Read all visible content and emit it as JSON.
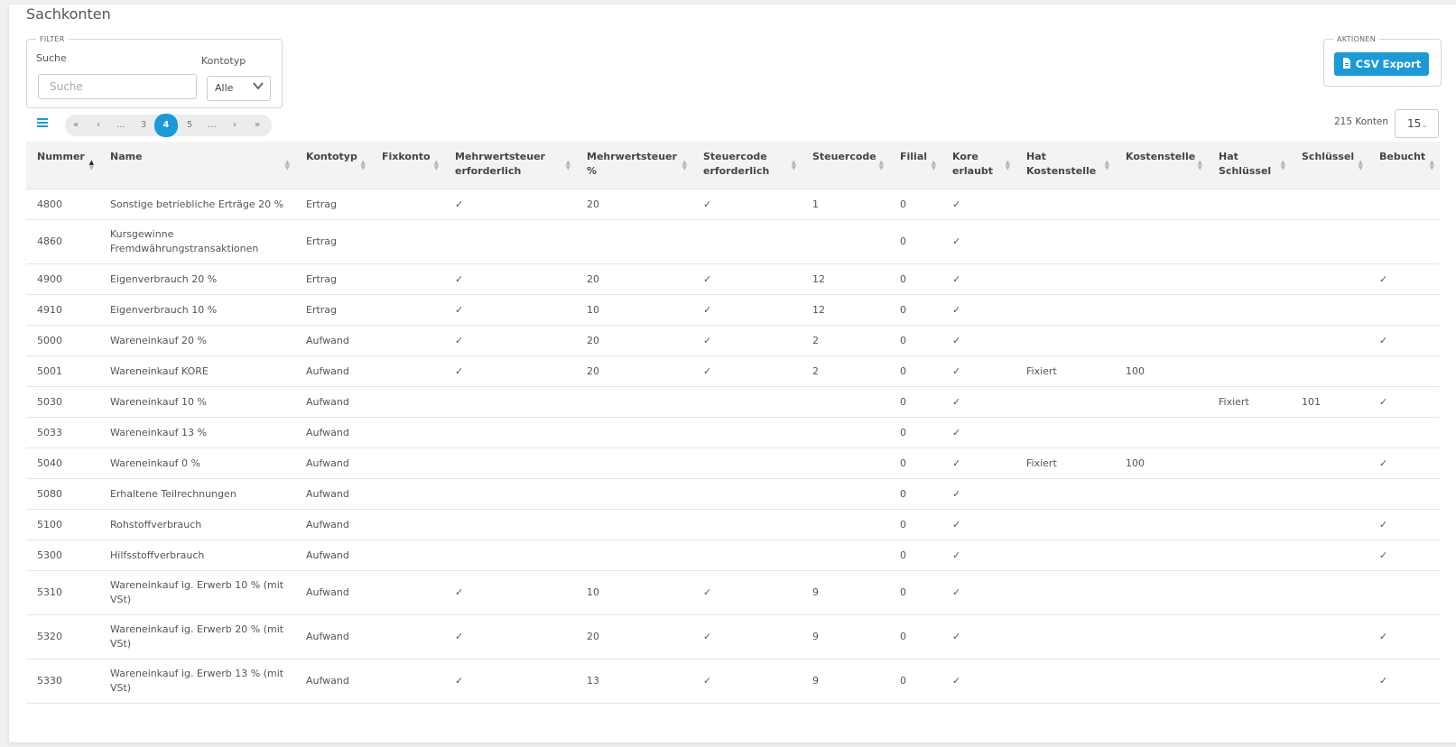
{
  "page": {
    "title": "Sachkonten"
  },
  "filter": {
    "legend": "FILTER",
    "search_label": "Suche",
    "search_placeholder": "Suche",
    "search_value": "",
    "type_label": "Kontotyp",
    "type_value": "Alle"
  },
  "actions": {
    "legend": "AKTIONEN",
    "csv_label": "CSV Export"
  },
  "pagination": {
    "first": "«",
    "prev": "‹",
    "ellipsis_left": "...",
    "page_before": "3",
    "current": "4",
    "page_after": "5",
    "ellipsis_right": "...",
    "next": "›",
    "last": "»"
  },
  "summary": {
    "count_text": "215 Konten",
    "per_page": "15"
  },
  "table": {
    "columns": [
      {
        "label": "Nummer",
        "sortable": true,
        "sorted": "asc"
      },
      {
        "label": "Name",
        "sortable": true
      },
      {
        "label": "Kontotyp",
        "sortable": true
      },
      {
        "label": "Fixkonto",
        "sortable": true
      },
      {
        "label": "Mehrwertsteuer erforderlich",
        "sortable": true
      },
      {
        "label": "Mehrwertsteuer %",
        "sortable": true
      },
      {
        "label": "Steuercode erforderlich",
        "sortable": true
      },
      {
        "label": "Steuercode",
        "sortable": true
      },
      {
        "label": "Filial",
        "sortable": true
      },
      {
        "label": "Kore erlaubt",
        "sortable": true
      },
      {
        "label": "Hat Kostenstelle",
        "sortable": true
      },
      {
        "label": "Kostenstelle",
        "sortable": true
      },
      {
        "label": "Hat Schlüssel",
        "sortable": true
      },
      {
        "label": "Schlüssel",
        "sortable": true
      },
      {
        "label": "Bebucht",
        "sortable": true
      }
    ],
    "rows": [
      [
        "4800",
        "Sonstige betriebliche Erträge 20 %",
        "Ertrag",
        "",
        "✓",
        "20",
        "✓",
        "1",
        "0",
        "✓",
        "",
        "",
        "",
        "",
        ""
      ],
      [
        "4860",
        "Kursgewinne Fremdwährungstransaktionen",
        "Ertrag",
        "",
        "",
        "",
        "",
        "",
        "0",
        "✓",
        "",
        "",
        "",
        "",
        ""
      ],
      [
        "4900",
        "Eigenverbrauch 20 %",
        "Ertrag",
        "",
        "✓",
        "20",
        "✓",
        "12",
        "0",
        "✓",
        "",
        "",
        "",
        "",
        "✓"
      ],
      [
        "4910",
        "Eigenverbrauch 10 %",
        "Ertrag",
        "",
        "✓",
        "10",
        "✓",
        "12",
        "0",
        "✓",
        "",
        "",
        "",
        "",
        ""
      ],
      [
        "5000",
        "Wareneinkauf 20 %",
        "Aufwand",
        "",
        "✓",
        "20",
        "✓",
        "2",
        "0",
        "✓",
        "",
        "",
        "",
        "",
        "✓"
      ],
      [
        "5001",
        "Wareneinkauf KORE",
        "Aufwand",
        "",
        "✓",
        "20",
        "✓",
        "2",
        "0",
        "✓",
        "Fixiert",
        "100",
        "",
        "",
        ""
      ],
      [
        "5030",
        "Wareneinkauf 10 %",
        "Aufwand",
        "",
        "",
        "",
        "",
        "",
        "0",
        "✓",
        "",
        "",
        "Fixiert",
        "101",
        "✓"
      ],
      [
        "5033",
        "Wareneinkauf 13 %",
        "Aufwand",
        "",
        "",
        "",
        "",
        "",
        "0",
        "✓",
        "",
        "",
        "",
        "",
        ""
      ],
      [
        "5040",
        "Wareneinkauf 0 %",
        "Aufwand",
        "",
        "",
        "",
        "",
        "",
        "0",
        "✓",
        "Fixiert",
        "100",
        "",
        "",
        "✓"
      ],
      [
        "5080",
        "Erhaltene Teilrechnungen",
        "Aufwand",
        "",
        "",
        "",
        "",
        "",
        "0",
        "✓",
        "",
        "",
        "",
        "",
        ""
      ],
      [
        "5100",
        "Rohstoffverbrauch",
        "Aufwand",
        "",
        "",
        "",
        "",
        "",
        "0",
        "✓",
        "",
        "",
        "",
        "",
        "✓"
      ],
      [
        "5300",
        "Hilfsstoffverbrauch",
        "Aufwand",
        "",
        "",
        "",
        "",
        "",
        "0",
        "✓",
        "",
        "",
        "",
        "",
        "✓"
      ],
      [
        "5310",
        "Wareneinkauf ig. Erwerb 10 % (mit VSt)",
        "Aufwand",
        "",
        "✓",
        "10",
        "✓",
        "9",
        "0",
        "✓",
        "",
        "",
        "",
        "",
        ""
      ],
      [
        "5320",
        "Wareneinkauf ig. Erwerb 20 % (mit VSt)",
        "Aufwand",
        "",
        "✓",
        "20",
        "✓",
        "9",
        "0",
        "✓",
        "",
        "",
        "",
        "",
        "✓"
      ],
      [
        "5330",
        "Wareneinkauf ig. Erwerb 13 % (mit VSt)",
        "Aufwand",
        "",
        "✓",
        "13",
        "✓",
        "9",
        "0",
        "✓",
        "",
        "",
        "",
        "",
        "✓"
      ]
    ]
  },
  "icons": {
    "menu": "list-icon",
    "csv": "file-csv-icon",
    "check": "check-icon",
    "sort": "sort-arrows-icon",
    "select_arrow": "chevron-down-icon"
  },
  "colors": {
    "accent": "#1a9ad9",
    "header_bg": "#f3f3f4",
    "page_bg": "#f0f0f2"
  }
}
